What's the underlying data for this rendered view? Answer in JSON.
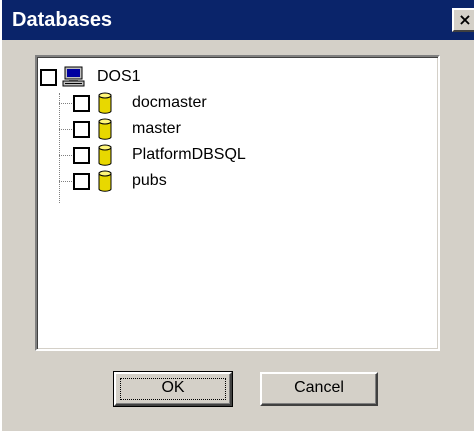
{
  "window": {
    "title": "Databases",
    "close_glyph": "×"
  },
  "tree": {
    "root": {
      "label": "DOS1",
      "icon": "computer-icon",
      "checked": false
    },
    "children": [
      {
        "label": "docmaster",
        "icon": "database-icon",
        "checked": false
      },
      {
        "label": "master",
        "icon": "database-icon",
        "checked": false
      },
      {
        "label": "PlatformDBSQL",
        "icon": "database-icon",
        "checked": false
      },
      {
        "label": "pubs",
        "icon": "database-icon",
        "checked": false
      }
    ]
  },
  "buttons": {
    "ok_label": "OK",
    "cancel_label": "Cancel"
  },
  "colors": {
    "titlebar": "#0a246a",
    "face": "#d4d0c8",
    "database_icon": "#e8d800"
  }
}
